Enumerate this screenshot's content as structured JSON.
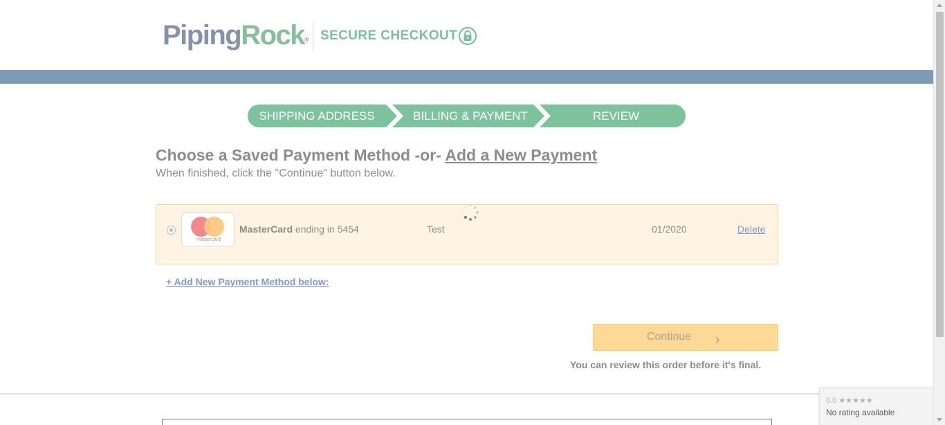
{
  "header": {
    "logo_part1": "Piping",
    "logo_part2": "Rock",
    "logo_mark": "®",
    "secure_label": "SECURE CHECKOUT",
    "secure_icon": "lock-icon"
  },
  "steps": [
    {
      "label": "SHIPPING ADDRESS"
    },
    {
      "label": "BILLING & PAYMENT"
    },
    {
      "label": "REVIEW"
    }
  ],
  "colors": {
    "brand_green": "#7cc29d",
    "brand_blue": "#7f9ab7",
    "link_blue": "#7f9ac9",
    "button_yellow": "#fed895"
  },
  "main": {
    "heading_prefix": "Choose a Saved Payment Method -or- ",
    "heading_link": "Add a New Payment",
    "subheading": "When finished, click the \"Continue\" button below.",
    "saved_card": {
      "brand": "MasterCard",
      "brand_logo_text": "mastercard",
      "ending_text": "ending in 5454",
      "holder": "Test",
      "expiry": "01/2020",
      "delete_label": "Delete"
    },
    "add_method_link": "+ Add New Payment Method below:",
    "continue_label": "Continue",
    "continue_icon": "chevron-right-icon",
    "review_note": "You can review this order before it's final."
  },
  "rating_widget": {
    "score_line": "0.0 ★★★★★",
    "status": "No rating available"
  }
}
